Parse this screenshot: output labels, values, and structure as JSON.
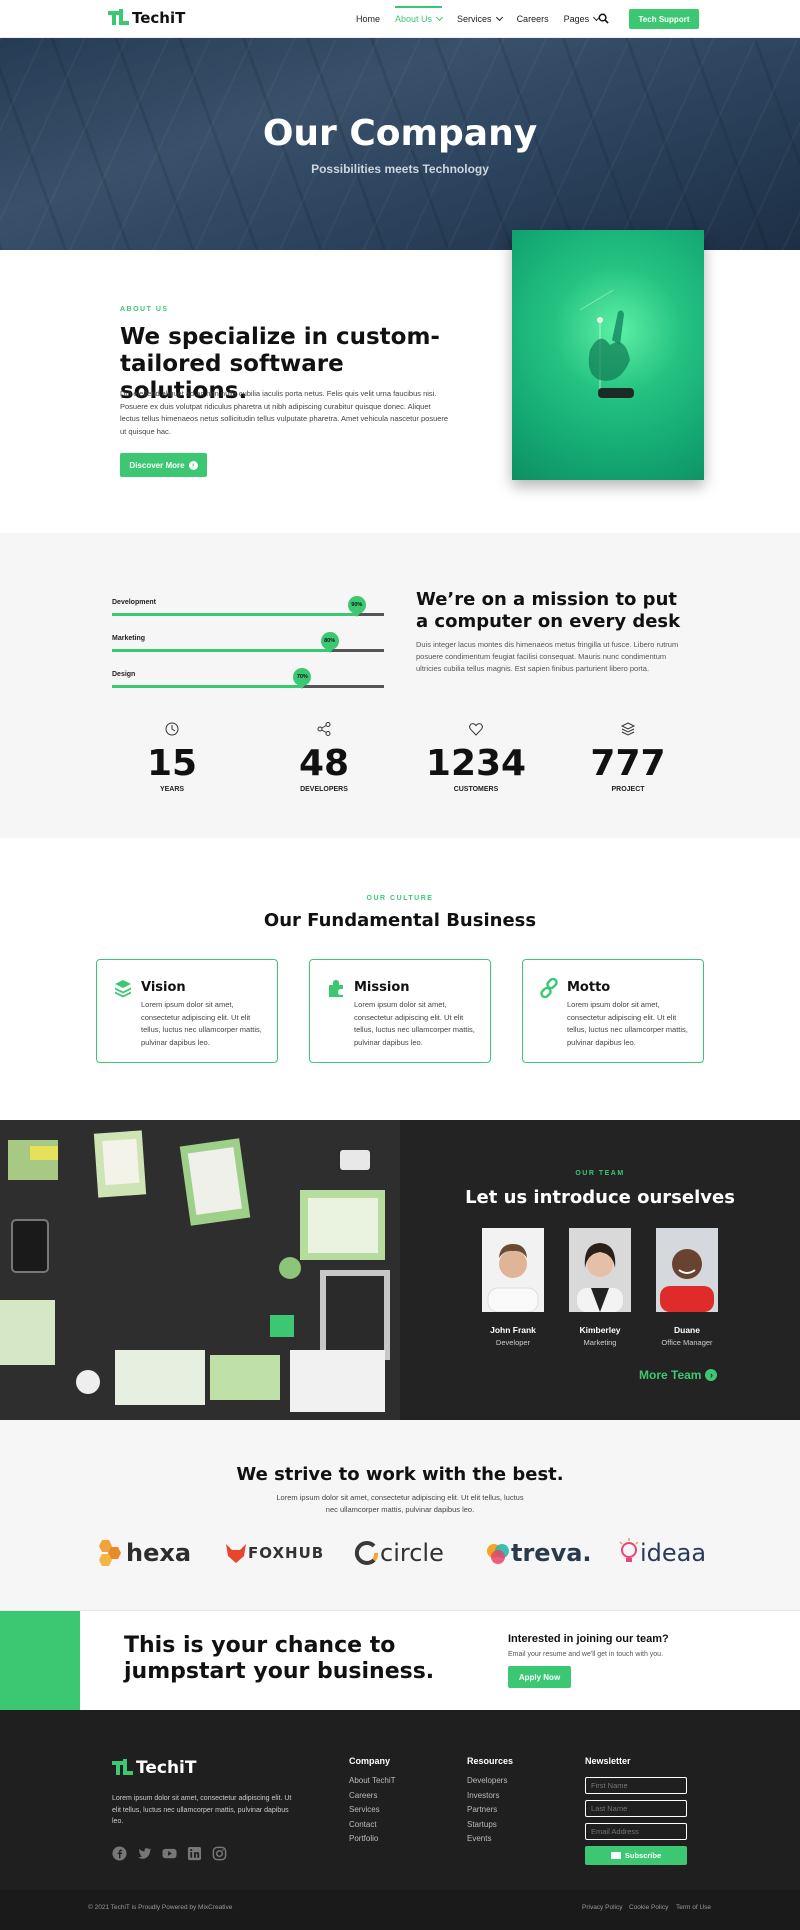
{
  "header": {
    "logo_text": "TechiT",
    "nav": [
      "Home",
      "About Us",
      "Services",
      "Careers",
      "Pages"
    ],
    "support_button": "Tech Support"
  },
  "hero": {
    "title": "Our Company",
    "subtitle": "Possibilities meets Technology"
  },
  "about": {
    "eyebrow": "ABOUT US",
    "title": "We specialize in custom-tailored software solutions.",
    "text": "Dui eleifend aliquet ad ac non nulla cubilia iaculis porta netus. Felis quis velit urna faucibus nisi. Posuere ex duis volutpat ridiculus pharetra ut nibh adipiscing curabitur quisque donec. Aliquet lectus tellus himenaeos netus sollicitudin tellus vulputate pharetra. Amet vehicula nascetur posuere ut quisque hac.",
    "button": "Discover More"
  },
  "skills": [
    {
      "label": "Development",
      "value": 90,
      "display": "90%"
    },
    {
      "label": "Marketing",
      "value": 80,
      "display": "80%"
    },
    {
      "label": "Design",
      "value": 70,
      "display": "70%"
    }
  ],
  "mission": {
    "title": "We’re on a mission to put a computer on every desk",
    "text": "Duis integer lacus montes dis himenaeos metus fringilla ut fusce. Libero rutrum posuere condimentum feugiat facilisi consequat. Mauris nunc condimentum ultricies cubilia tellus magnis. Est sapien finibus parturient libero porta."
  },
  "stats": [
    {
      "icon": "clock-icon",
      "value": "15",
      "label": "YEARS"
    },
    {
      "icon": "share-icon",
      "value": "48",
      "label": "DEVELOPERS"
    },
    {
      "icon": "heart-icon",
      "value": "1234",
      "label": "CUSTOMERS"
    },
    {
      "icon": "layers-icon",
      "value": "777",
      "label": "PROJECT"
    }
  ],
  "culture": {
    "eyebrow": "OUR CULTURE",
    "title": "Our Fundamental Business",
    "cards": [
      {
        "icon": "layers-icon",
        "title": "Vision",
        "text": "Lorem ipsum dolor sit amet, consectetur adipiscing elit. Ut elit tellus, luctus nec ullamcorper mattis, pulvinar dapibus leo."
      },
      {
        "icon": "puzzle-icon",
        "title": "Mission",
        "text": "Lorem ipsum dolor sit amet, consectetur adipiscing elit. Ut elit tellus, luctus nec ullamcorper mattis, pulvinar dapibus leo."
      },
      {
        "icon": "link-icon",
        "title": "Motto",
        "text": "Lorem ipsum dolor sit amet, consectetur adipiscing elit. Ut elit tellus, luctus nec ullamcorper mattis, pulvinar dapibus leo."
      }
    ]
  },
  "team": {
    "eyebrow": "OUR TEAM",
    "title": "Let us introduce ourselves",
    "members": [
      {
        "name": "John Frank",
        "role": "Developer"
      },
      {
        "name": "Kimberley",
        "role": "Marketing"
      },
      {
        "name": "Duane",
        "role": "Office Manager"
      }
    ],
    "more": "More Team"
  },
  "partners": {
    "title": "We strive to work with the best.",
    "text": "Lorem ipsum dolor sit amet, consectetur adipiscing elit. Ut elit tellus, luctus nec ullamcorper mattis, pulvinar dapibus leo.",
    "logos": [
      "hexa",
      "FOXHUB",
      "circle",
      "treva.",
      "ideaa"
    ]
  },
  "cta": {
    "title": "This is your chance to jumpstart your business.",
    "subtitle": "Interested in joining our team?",
    "text": "Email your resume and we'll get in touch with you.",
    "button": "Apply Now"
  },
  "footer": {
    "logo_text": "TechiT",
    "text": "Lorem ipsum dolor sit amet, consectetur adipiscing elit. Ut elit tellus, luctus nec ullamcorper mattis, pulvinar dapibus leo.",
    "company": {
      "title": "Company",
      "links": [
        "About TechiT",
        "Careers",
        "Services",
        "Contact",
        "Portfolio"
      ]
    },
    "resources": {
      "title": "Resources",
      "links": [
        "Developers",
        "Investors",
        "Partners",
        "Startups",
        "Events"
      ]
    },
    "newsletter": {
      "title": "Newsletter",
      "first_name": "First Name",
      "last_name": "Last Name",
      "email": "Email Address",
      "button": "Subscribe"
    },
    "copyright": "© 2021 TechiT is Proudly Powered by MixCreative",
    "legal": [
      "Privacy Policy",
      "Cookie Policy",
      "Term of Use"
    ]
  },
  "colors": {
    "accent": "#3cc873",
    "dark": "#1f1f1f",
    "light_bg": "#f6f6f6"
  }
}
